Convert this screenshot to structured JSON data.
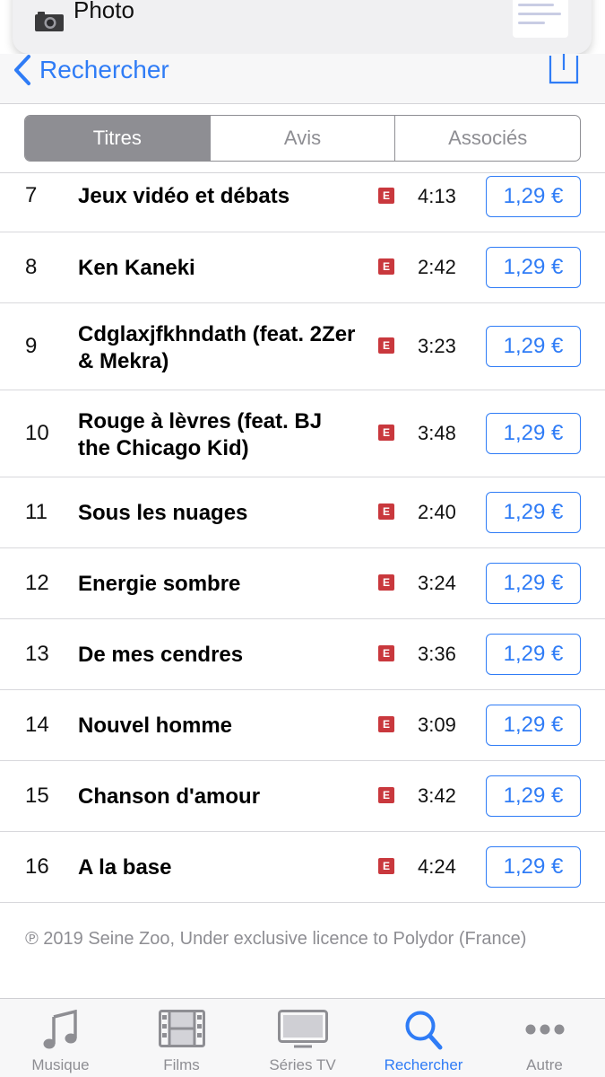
{
  "notification": {
    "text": "Photo",
    "camera_icon": "camera-icon"
  },
  "nav": {
    "back_label": "Rechercher",
    "accent": "#2f7cf6"
  },
  "segments": [
    {
      "label": "Titres",
      "active": true
    },
    {
      "label": "Avis",
      "active": false
    },
    {
      "label": "Associés",
      "active": false
    }
  ],
  "tracks": [
    {
      "number": "7",
      "title": "Jeux vidéo et débats",
      "explicit": "E",
      "duration": "4:13",
      "price": "1,29 €"
    },
    {
      "number": "8",
      "title": "Ken Kaneki",
      "explicit": "E",
      "duration": "2:42",
      "price": "1,29 €"
    },
    {
      "number": "9",
      "title": "Cdglaxjfkhndath (feat. 2Zer & Mekra)",
      "explicit": "E",
      "duration": "3:23",
      "price": "1,29 €"
    },
    {
      "number": "10",
      "title": "Rouge à lèvres (feat. BJ the Chicago Kid)",
      "explicit": "E",
      "duration": "3:48",
      "price": "1,29 €"
    },
    {
      "number": "11",
      "title": "Sous les nuages",
      "explicit": "E",
      "duration": "2:40",
      "price": "1,29 €"
    },
    {
      "number": "12",
      "title": "Energie sombre",
      "explicit": "E",
      "duration": "3:24",
      "price": "1,29 €"
    },
    {
      "number": "13",
      "title": "De mes cendres",
      "explicit": "E",
      "duration": "3:36",
      "price": "1,29 €"
    },
    {
      "number": "14",
      "title": "Nouvel homme",
      "explicit": "E",
      "duration": "3:09",
      "price": "1,29 €"
    },
    {
      "number": "15",
      "title": "Chanson d'amour",
      "explicit": "E",
      "duration": "3:42",
      "price": "1,29 €"
    },
    {
      "number": "16",
      "title": "A la base",
      "explicit": "E",
      "duration": "4:24",
      "price": "1,29 €"
    }
  ],
  "copyright": "℗ 2019 Seine Zoo, Under exclusive licence to Polydor (France)",
  "tabbar": [
    {
      "label": "Musique",
      "icon": "music-note-icon",
      "active": false
    },
    {
      "label": "Films",
      "icon": "film-icon",
      "active": false
    },
    {
      "label": "Séries TV",
      "icon": "tv-icon",
      "active": false
    },
    {
      "label": "Rechercher",
      "icon": "search-icon",
      "active": true
    },
    {
      "label": "Autre",
      "icon": "more-icon",
      "active": false
    }
  ]
}
